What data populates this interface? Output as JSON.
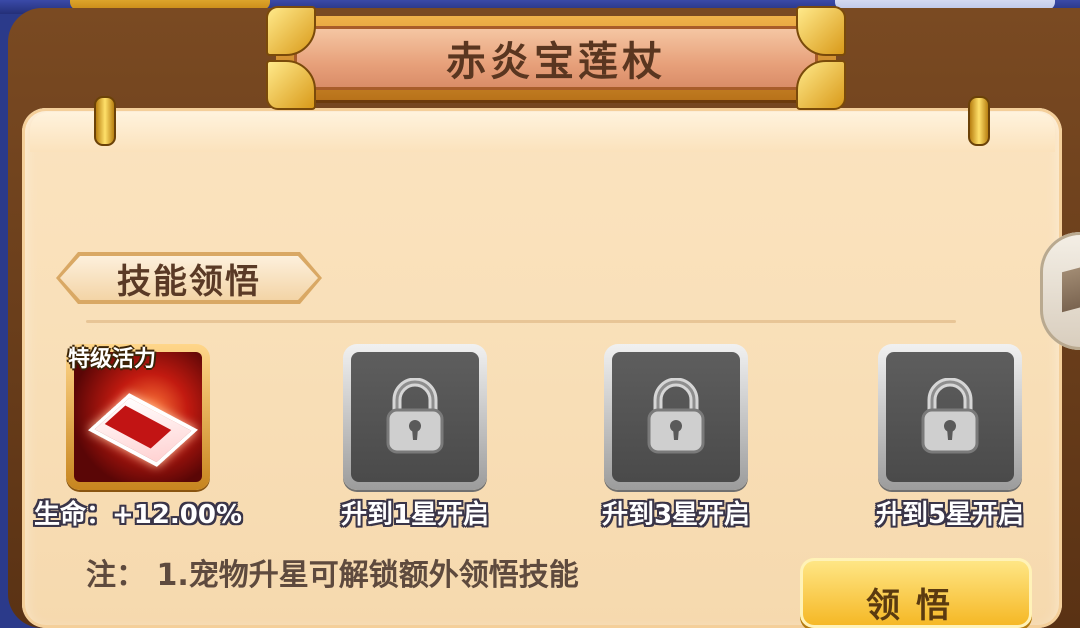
{
  "title": "赤炎宝莲杖",
  "section": {
    "title": "技能领悟"
  },
  "skills": [
    {
      "name": "特级活力",
      "label": "生命：+12.00%",
      "locked": false,
      "icon": "red-talisman-icon"
    },
    {
      "name": "",
      "label": "升到1星开启",
      "locked": true,
      "icon": "lock-icon"
    },
    {
      "name": "",
      "label": "升到3星开启",
      "locked": true,
      "icon": "lock-icon"
    },
    {
      "name": "",
      "label": "升到5星开启",
      "locked": true,
      "icon": "lock-icon"
    }
  ],
  "note": "注：  1.宠物升星可解锁额外领悟技能",
  "button": {
    "label": "领悟"
  },
  "colors": {
    "parchment": "#f9e0b9",
    "wood": "#6b3e1a",
    "button": "#f5b621",
    "title_text": "#5a3620"
  }
}
